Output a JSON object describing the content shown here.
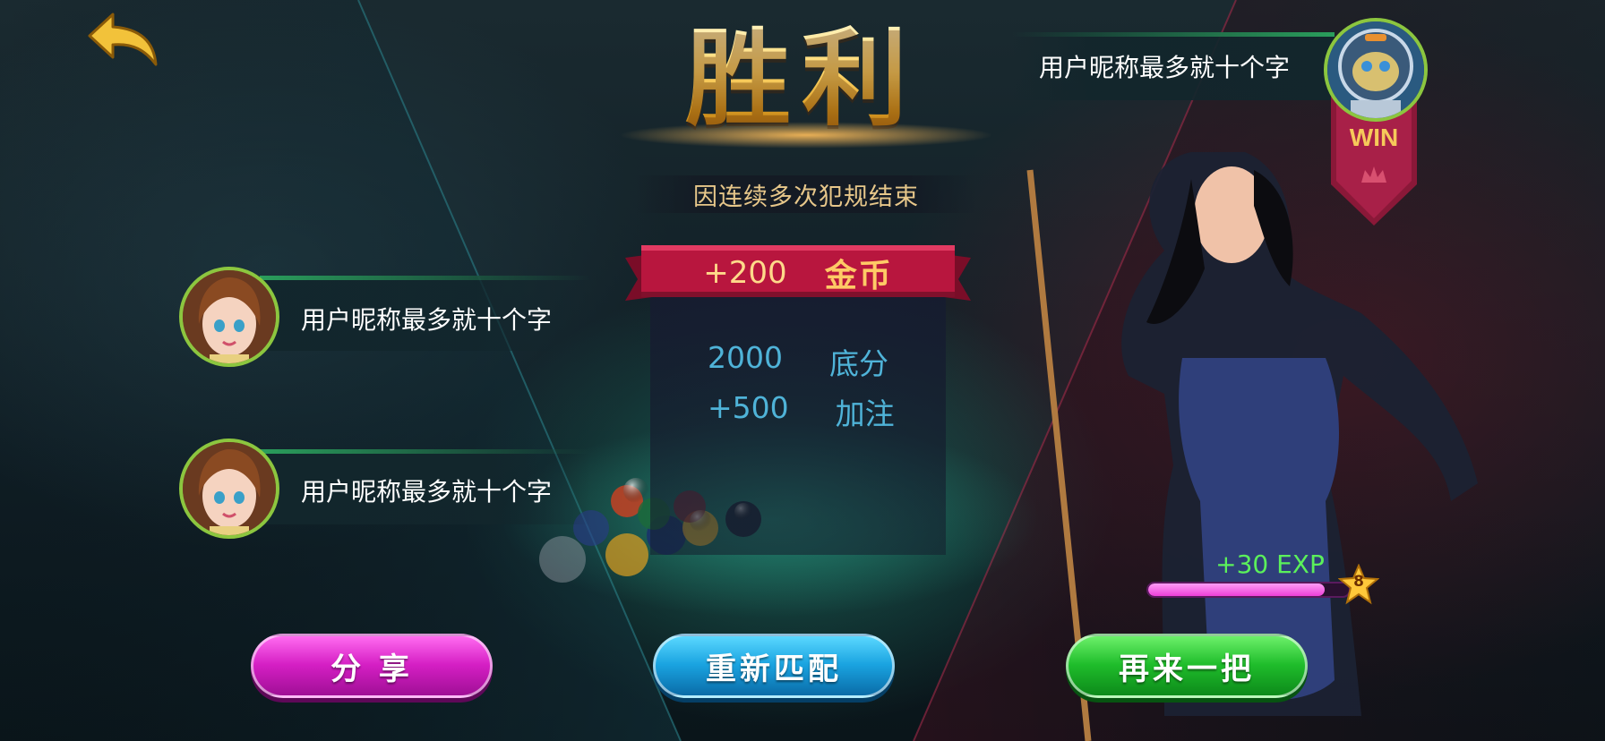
{
  "header": {
    "title": "胜利",
    "reason": "因连续多次犯规结束"
  },
  "reward": {
    "coins_amount": "+200",
    "coins_label": "金币",
    "rows": [
      {
        "value": "2000",
        "label": "底分"
      },
      {
        "value": "+500",
        "label": "加注"
      }
    ]
  },
  "players": {
    "opponents": [
      {
        "name": "用户昵称最多就十个字"
      },
      {
        "name": "用户昵称最多就十个字"
      }
    ],
    "winner": {
      "name": "用户昵称最多就十个字",
      "badge": "WIN"
    }
  },
  "experience": {
    "text": "+30  EXP",
    "level": "8",
    "progress_fraction": 0.88
  },
  "buttons": {
    "share": "分 享",
    "rematch": "重新匹配",
    "play_again": "再来一把"
  },
  "colors": {
    "title_gold": "#ffd76a",
    "reason_text": "#e7c78a",
    "reward_row_text": "#4fb3d8",
    "ribbon_red": "#b8163e",
    "share_button": "#d51fc4",
    "rematch_button": "#1aa3e0",
    "again_button": "#1fbd2b",
    "exp_text": "#5bf05b",
    "avatar_ring": "#8cc63f"
  },
  "icons": {
    "back": "back-arrow-icon",
    "level": "star-icon",
    "crown": "crown-icon"
  }
}
